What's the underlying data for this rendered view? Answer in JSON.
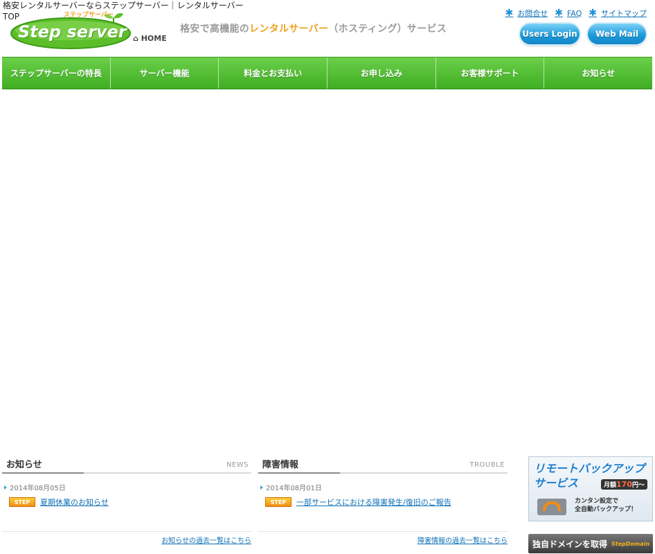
{
  "header": {
    "site_title": "格安レンタルサーバーならステップサーバー｜レンタルサーバー TOP",
    "logo_text": "Step server",
    "logo_ruby": "ステップサーバー",
    "home_label": "HOME",
    "tagline_pre": "格安で高機能の",
    "tagline_accent": "レンタルサーバー",
    "tagline_post": "（ホスティング）サービス",
    "top_links": [
      "お問合せ",
      "FAQ",
      "サイトマップ"
    ],
    "users_login": "Users Login",
    "web_mail": "Web Mail"
  },
  "nav": [
    "ステップサーバーの特長",
    "サーバー機能",
    "料金とお支払い",
    "お申し込み",
    "お客様サポート",
    "お知らせ"
  ],
  "news": {
    "title": "お知らせ",
    "title_en": "NEWS",
    "date": "2014年08月05日",
    "badge": "STEP",
    "item": "夏期休業のお知らせ",
    "more": "お知らせの過去一覧はこちら"
  },
  "trouble": {
    "title": "障害情報",
    "title_en": "TROUBLE",
    "date": "2014年08月01日",
    "badge": "STEP",
    "item": "一部サービスにおける障害発生/復旧のご報告",
    "more": "障害情報の過去一覧はこちら"
  },
  "banners": {
    "backup_line1": "リモートバックアップ",
    "backup_line2": "サービス",
    "backup_price_pre": "月額",
    "backup_price": "170",
    "backup_price_post": "円〜",
    "backup_desc1": "カンタン設定で",
    "backup_desc2": "全自動バックアップ！",
    "domain_label": "独自ドメインを取得",
    "domain_brand": "StepDomain"
  },
  "colors": {
    "nav_green": "#4dbb2e",
    "link_blue": "#0d6fb8",
    "accent_orange": "#f0a020"
  }
}
